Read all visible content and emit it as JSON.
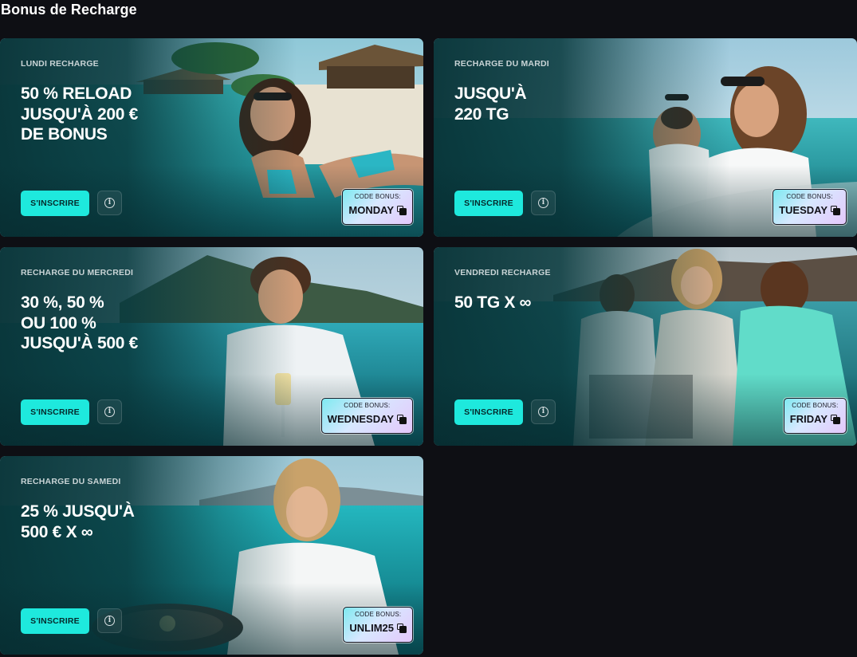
{
  "page": {
    "title": "Bonus de Recharge"
  },
  "cards": [
    {
      "label": "LUNDI RECHARGE",
      "headline": "50 % RELOAD\nJUSQU'À 200 €\nDE BONUS",
      "signup": "S'INSCRIRE",
      "code_label": "CODE BONUS:",
      "code": "MONDAY"
    },
    {
      "label": "RECHARGE DU MARDI",
      "headline": "JUSQU'À\n220 TG",
      "signup": "S'INSCRIRE",
      "code_label": "CODE BONUS:",
      "code": "TUESDAY"
    },
    {
      "label": "RECHARGE DU MERCREDI",
      "headline": "30 %, 50 %\nOU 100 %\nJUSQU'À 500 €",
      "signup": "S'INSCRIRE",
      "code_label": "CODE BONUS:",
      "code": "WEDNESDAY"
    },
    {
      "label": "VENDREDI RECHARGE",
      "headline": "50 TG X ∞",
      "signup": "S'INSCRIRE",
      "code_label": "CODE BONUS:",
      "code": "FRIDAY"
    },
    {
      "label": "RECHARGE DU SAMEDI",
      "headline": "25 % JUSQU'À\n500 € X ∞",
      "signup": "S'INSCRIRE",
      "code_label": "CODE BONUS:",
      "code": "UNLIM25"
    }
  ],
  "colors": {
    "background": "#0e0f14",
    "accent": "#1ee9dd",
    "card_teal": "#0b3f45"
  },
  "icons": {
    "info": "info-circle-icon",
    "copy": "copy-icon"
  }
}
